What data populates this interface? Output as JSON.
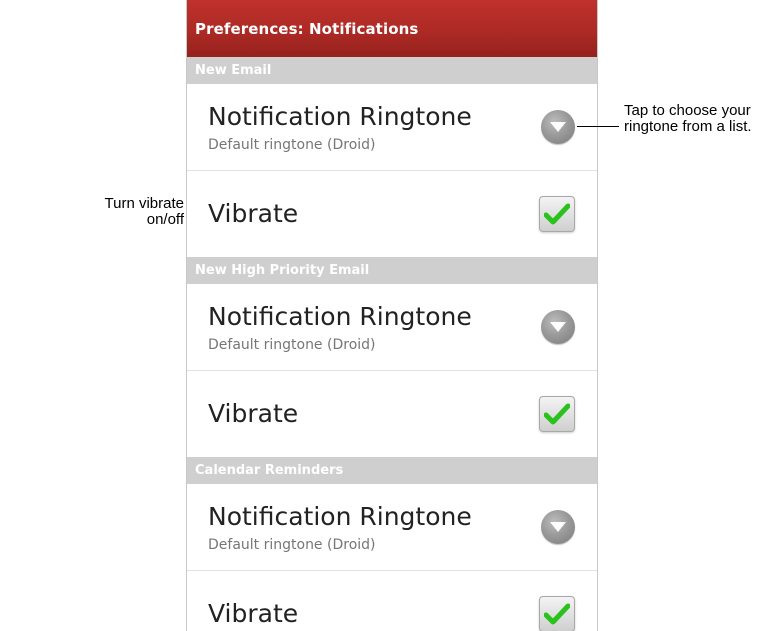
{
  "screen": {
    "title": "Preferences: Notifications"
  },
  "sections": [
    {
      "header": "New Email",
      "ringtone": {
        "title": "Notification Ringtone",
        "subtitle": "Default ringtone (Droid)"
      },
      "vibrate": {
        "title": "Vibrate",
        "checked": true
      }
    },
    {
      "header": "New High Priority Email",
      "ringtone": {
        "title": "Notification Ringtone",
        "subtitle": "Default ringtone (Droid)"
      },
      "vibrate": {
        "title": "Vibrate",
        "checked": true
      }
    },
    {
      "header": "Calendar Reminders",
      "ringtone": {
        "title": "Notification Ringtone",
        "subtitle": "Default ringtone (Droid)"
      },
      "vibrate": {
        "title": "Vibrate",
        "checked": true
      }
    }
  ],
  "callouts": {
    "ringtone": "Tap to choose your ringtone from a list.",
    "vibrate": "Turn vibrate on/off"
  },
  "icons": {
    "dropdown": "chevron-down-icon",
    "checkbox": "checkmark-icon"
  },
  "colors": {
    "title_bar": "#ad2a25",
    "section_header": "#cfcfcf",
    "checkmark": "#2bc21e"
  }
}
